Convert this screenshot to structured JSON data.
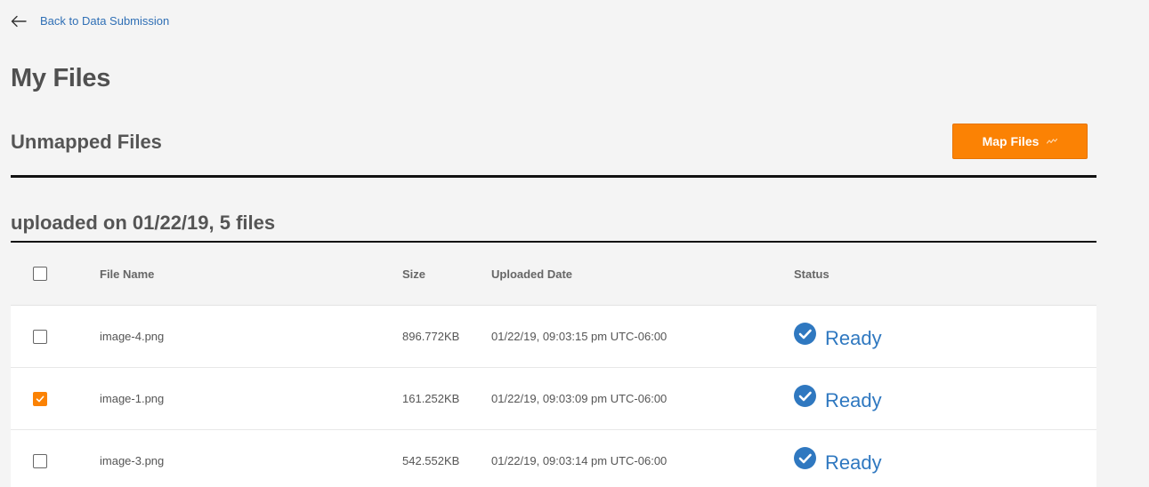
{
  "nav": {
    "back_label": "Back to Data Submission",
    "back_icon": "arrow-left-icon"
  },
  "page": {
    "title": "My Files"
  },
  "section": {
    "title": "Unmapped Files",
    "map_button_label": "Map Files",
    "map_button_icon": "activity-icon",
    "accent_color": "#fb8204"
  },
  "group": {
    "title": "uploaded on 01/22/19, 5 files"
  },
  "table": {
    "columns": [
      "File Name",
      "Size",
      "Uploaded Date",
      "Status"
    ],
    "rows": [
      {
        "name": "image-4.png",
        "size": "896.772KB",
        "date": "01/22/19, 09:03:15 pm UTC-06:00",
        "status": "Ready",
        "checked": false
      },
      {
        "name": "image-1.png",
        "size": "161.252KB",
        "date": "01/22/19, 09:03:09 pm UTC-06:00",
        "status": "Ready",
        "checked": true
      },
      {
        "name": "image-3.png",
        "size": "542.552KB",
        "date": "01/22/19, 09:03:14 pm UTC-06:00",
        "status": "Ready",
        "checked": false
      }
    ],
    "status_color": "#2f78c0"
  }
}
